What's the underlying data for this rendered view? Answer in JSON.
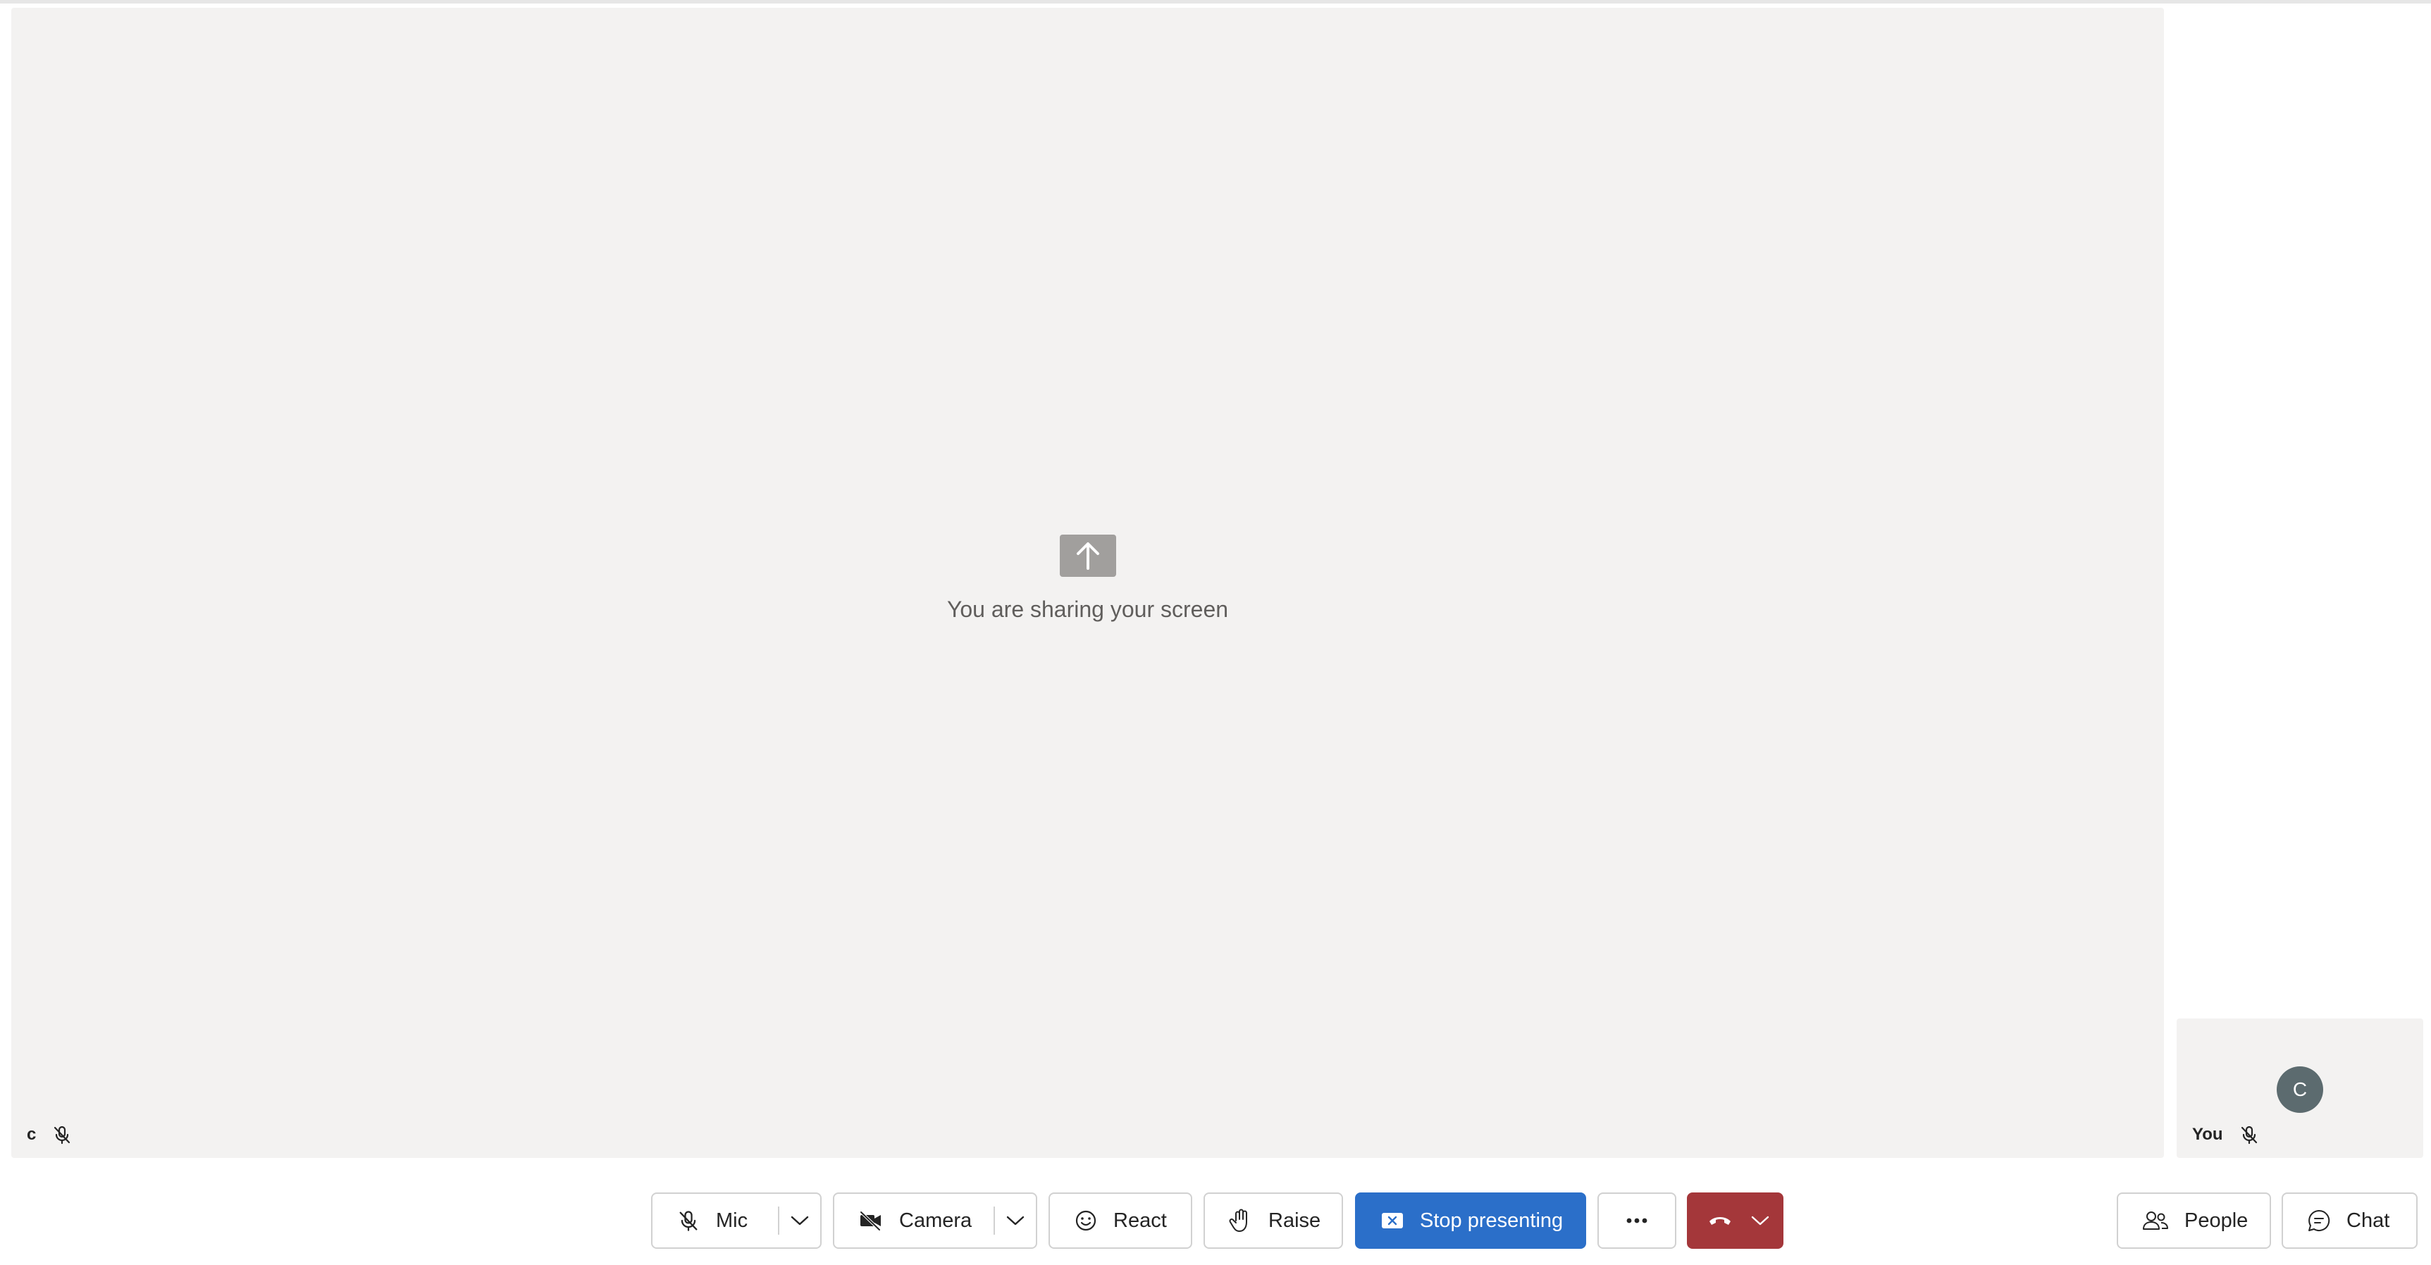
{
  "stage": {
    "sharing_text": "You are sharing your screen",
    "participant_name": "c"
  },
  "self_tile": {
    "avatar_initial": "C",
    "label": "You"
  },
  "toolbar": {
    "mic_label": "Mic",
    "camera_label": "Camera",
    "react_label": "React",
    "raise_label": "Raise",
    "stop_presenting_label": "Stop presenting",
    "people_label": "People",
    "chat_label": "Chat"
  },
  "icons": [
    "share-screen-icon",
    "mic-off-icon",
    "camera-off-icon",
    "chevron-down-icon",
    "smiley-icon",
    "hand-icon",
    "stop-share-icon",
    "more-icon",
    "hang-up-icon",
    "people-icon",
    "chat-icon"
  ],
  "colors": {
    "primary": "#2b6fc9",
    "danger": "#a4373a",
    "stage": "#f3f2f1"
  }
}
